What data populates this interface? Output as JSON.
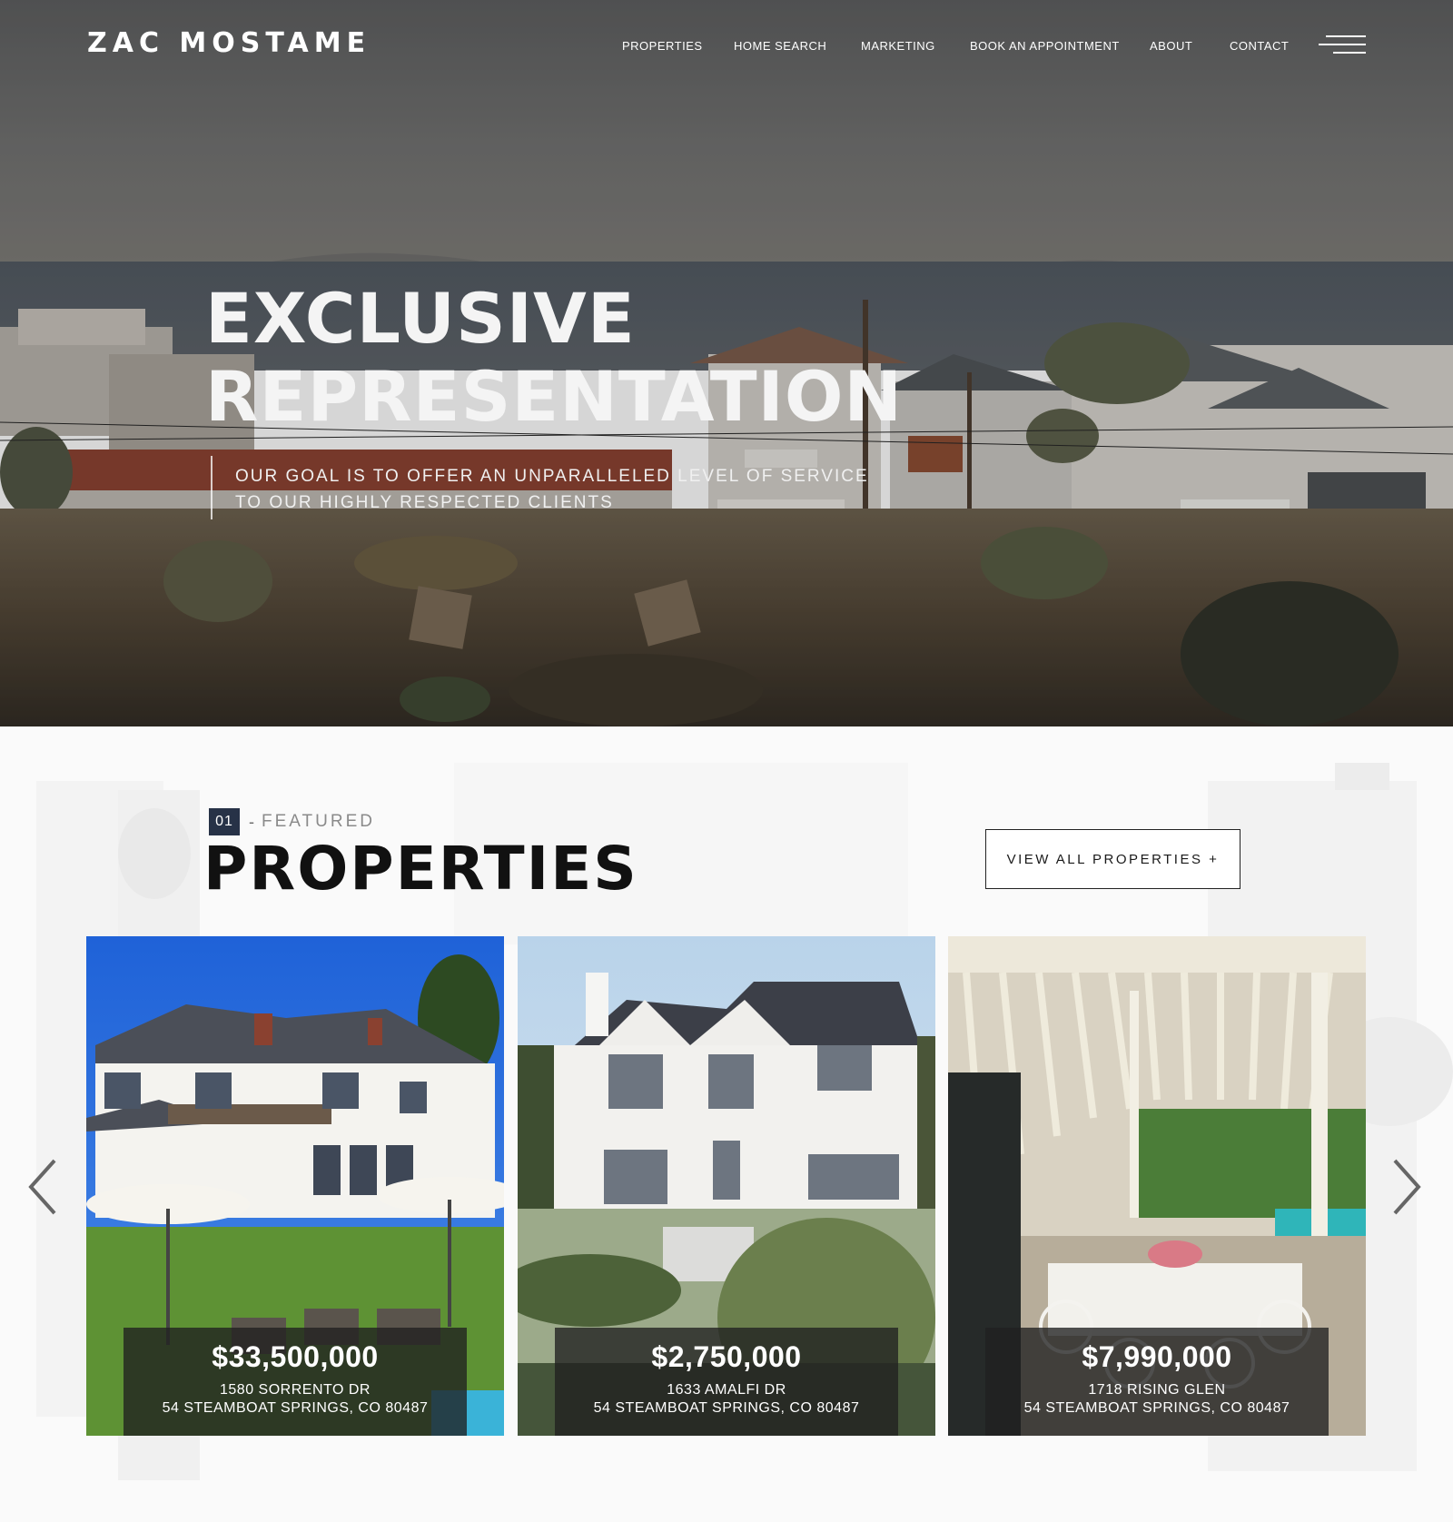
{
  "brand": {
    "name": "ZAC MOSTAME"
  },
  "nav": {
    "items": [
      {
        "label": "PROPERTIES"
      },
      {
        "label": "HOME SEARCH"
      },
      {
        "label": "MARKETING"
      },
      {
        "label": "BOOK AN APPOINTMENT"
      },
      {
        "label": "ABOUT"
      },
      {
        "label": "CONTACT"
      }
    ],
    "menu_icon": "hamburger-menu-icon"
  },
  "hero": {
    "title_line1": "EXCLUSIVE",
    "title_line2": "REPRESENTATION",
    "subtitle_line1": "OUR GOAL IS TO OFFER AN UNPARALLELED LEVEL OF SERVICE",
    "subtitle_line2": "TO OUR HIGHLY RESPECTED CLIENTS"
  },
  "featured": {
    "number": "01",
    "dash": "-",
    "eyebrow": "FEATURED",
    "title": "PROPERTIES",
    "view_all_label": "VIEW ALL PROPERTIES +",
    "prev_icon": "chevron-left-icon",
    "next_icon": "chevron-right-icon",
    "properties": [
      {
        "price": "$33,500,000",
        "street": "1580 SORRENTO DR",
        "city": "54 STEAMBOAT SPRINGS, CO 80487"
      },
      {
        "price": "$2,750,000",
        "street": "1633 AMALFI DR",
        "city": "54 STEAMBOAT SPRINGS, CO 80487"
      },
      {
        "price": "$7,990,000",
        "street": "1718 RISING GLEN",
        "city": "54 STEAMBOAT SPRINGS, CO 80487"
      }
    ]
  },
  "colors": {
    "accent_navy": "#273247",
    "dark_text": "#111111",
    "overlay": "#202020"
  }
}
